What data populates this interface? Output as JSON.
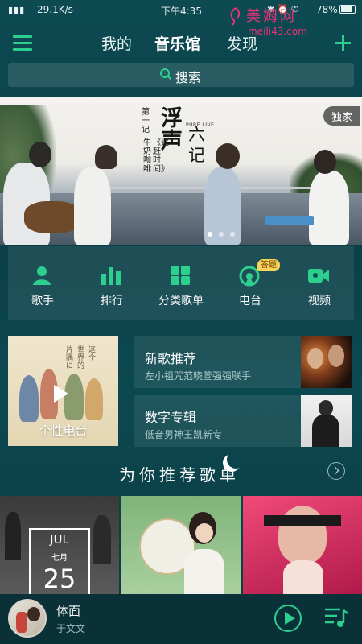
{
  "status": {
    "speed": "29.1K/s",
    "time": "下午4:35",
    "battery": "78%"
  },
  "watermark": {
    "title": "美姆网",
    "url": "meili43.com"
  },
  "header": {
    "tabs": [
      {
        "label": "我的"
      },
      {
        "label": "音乐馆"
      },
      {
        "label": "发现"
      }
    ]
  },
  "search": {
    "label": "搜索"
  },
  "banner": {
    "title_big": "浮声",
    "title_side": "六记",
    "episode": "第一记",
    "subtitle": "牛奶咖啡",
    "song": "《追赶时间》",
    "tag_latin": "PURE LIVE",
    "exclusive": "独家",
    "dots_total": 3,
    "dot_active": 0
  },
  "categories": [
    {
      "label": "歌手",
      "icon": "singer-icon"
    },
    {
      "label": "排行",
      "icon": "chart-icon"
    },
    {
      "label": "分类歌单",
      "icon": "grid-icon"
    },
    {
      "label": "电台",
      "icon": "radio-icon",
      "badge": "答题"
    },
    {
      "label": "视频",
      "icon": "video-icon"
    }
  ],
  "featured": {
    "radio": {
      "label": "个性电台",
      "cover_text": [
        "这",
        "个",
        "世",
        "界",
        "的",
        "片",
        "隅",
        "に"
      ]
    },
    "cards": [
      {
        "title": "新歌推荐",
        "subtitle": "左小祖咒范晓萱强强联手"
      },
      {
        "title": "数字专辑",
        "subtitle": "低音男神王凯新专"
      }
    ]
  },
  "recommend": {
    "title": "为你推荐歌单"
  },
  "playlists": [
    {
      "date_month": "JUL",
      "date_cn": "七月",
      "date_day": "25"
    },
    {},
    {}
  ],
  "now_playing": {
    "song": "体面",
    "artist": "于文文"
  },
  "colors": {
    "accent": "#2dcf8e",
    "background": "#0c4850",
    "badge": "#f7d35a"
  }
}
